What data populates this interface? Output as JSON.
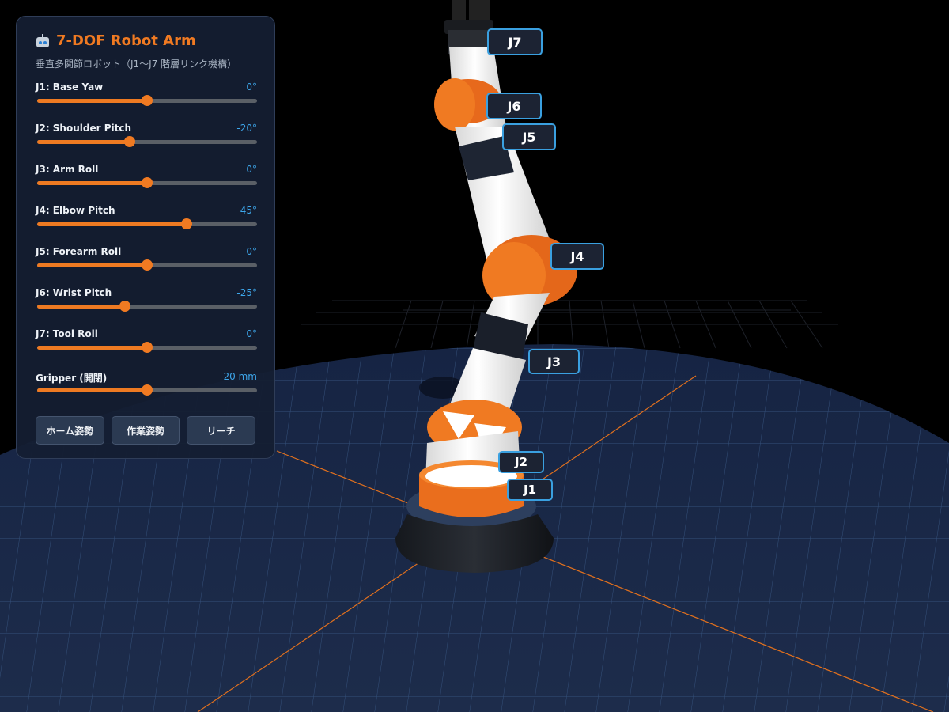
{
  "panel": {
    "title": "7-DOF Robot Arm",
    "icon": "robot-icon",
    "subtitle": "垂直多関節ロボット（J1〜J7 階層リンク機構）",
    "joints": [
      {
        "label": "J1: Base Yaw",
        "value": "0°",
        "fraction": 0.5
      },
      {
        "label": "J2: Shoulder Pitch",
        "value": "-20°",
        "fraction": 0.42
      },
      {
        "label": "J3: Arm Roll",
        "value": "0°",
        "fraction": 0.5
      },
      {
        "label": "J4: Elbow Pitch",
        "value": "45°",
        "fraction": 0.68
      },
      {
        "label": "J5: Forearm Roll",
        "value": "0°",
        "fraction": 0.5
      },
      {
        "label": "J6: Wrist Pitch",
        "value": "-25°",
        "fraction": 0.4
      },
      {
        "label": "J7: Tool Roll",
        "value": "0°",
        "fraction": 0.5
      },
      {
        "label": "Gripper (開閉)",
        "value": "20 mm",
        "fraction": 0.5
      }
    ],
    "buttons": [
      "ホーム姿勢",
      "作業姿勢",
      "リーチ"
    ]
  },
  "scene": {
    "joint_labels": [
      "J1",
      "J2",
      "J3",
      "J4",
      "J5",
      "J6",
      "J7"
    ]
  },
  "colors": {
    "accent": "#f07a22",
    "value_blue": "#3da6ea",
    "panel_bg": "#141e32",
    "label_border": "#3aa0e0",
    "floor": "#1b2a48"
  }
}
